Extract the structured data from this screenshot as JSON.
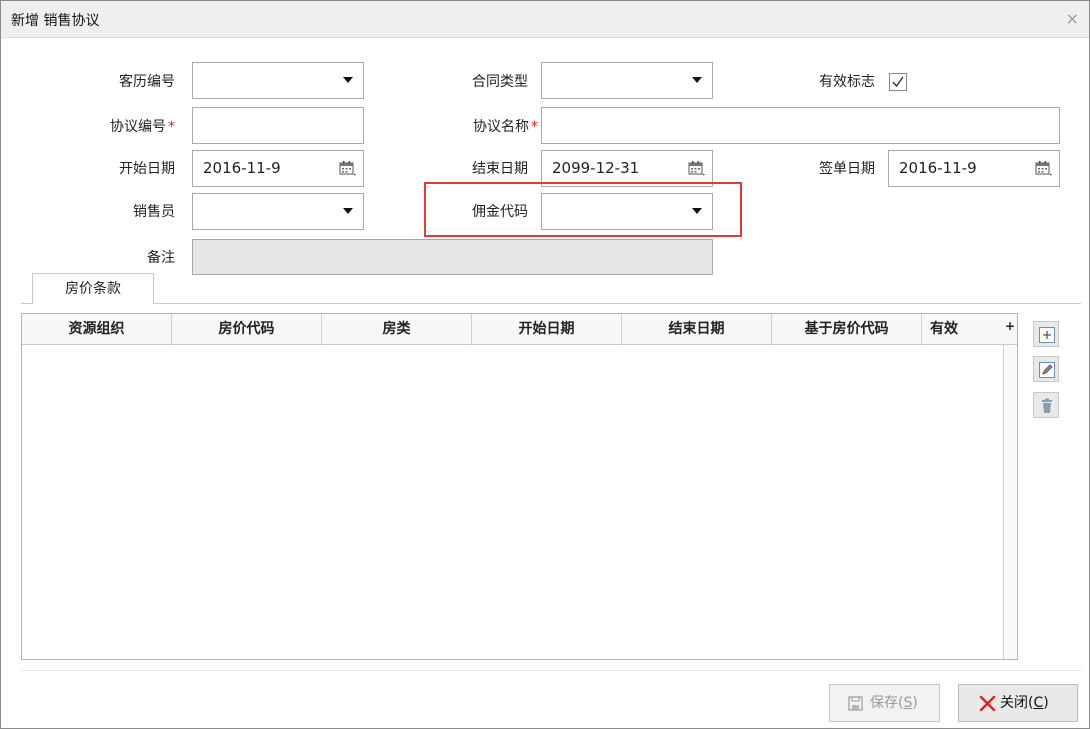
{
  "dialog": {
    "title": "新增 销售协议",
    "close": "×"
  },
  "form": {
    "customer_no": {
      "label": "客历编号",
      "value": ""
    },
    "contract_type": {
      "label": "合同类型",
      "value": ""
    },
    "valid_flag": {
      "label": "有效标志",
      "checked": true
    },
    "agreement_no": {
      "label": "协议编号",
      "required_mark": "*",
      "value": ""
    },
    "agreement_name": {
      "label": "协议名称",
      "required_mark": "*",
      "value": ""
    },
    "start_date": {
      "label": "开始日期",
      "value": "2016-11-9"
    },
    "end_date": {
      "label": "结束日期",
      "value": "2099-12-31"
    },
    "sign_date": {
      "label": "签单日期",
      "value": "2016-11-9"
    },
    "salesperson": {
      "label": "销售员",
      "value": ""
    },
    "commission_code": {
      "label": "佣金代码",
      "value": ""
    },
    "remark": {
      "label": "备注",
      "value": ""
    }
  },
  "tabs": [
    {
      "label": "房价条款",
      "active": true
    }
  ],
  "grid": {
    "columns": [
      "资源组织",
      "房价代码",
      "房类",
      "开始日期",
      "结束日期",
      "基于房价代码",
      "有效"
    ],
    "plus": "+",
    "rows": []
  },
  "buttons": {
    "save_prefix": "保存(",
    "save_key": "S",
    "save_suffix": ")",
    "close_prefix": "关闭(",
    "close_key": "C",
    "close_suffix": ")"
  },
  "colors": {
    "highlight": "#e53935",
    "required": "#e02020",
    "close_icon": "#e02020"
  }
}
